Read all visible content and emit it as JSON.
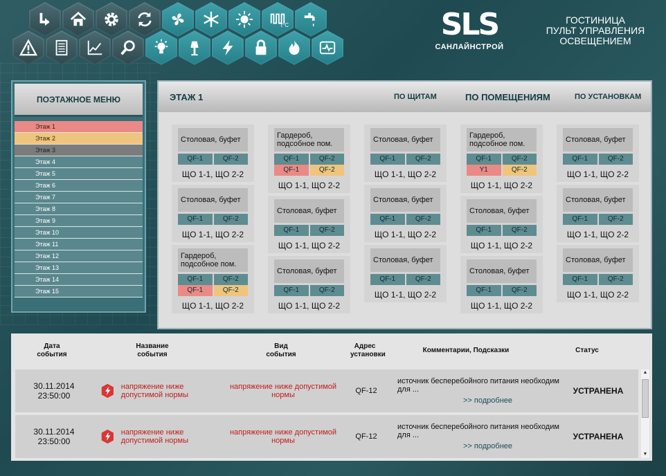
{
  "toolbar": {
    "row1": [
      {
        "icon": "back-arrow-icon"
      },
      {
        "icon": "home-icon"
      },
      {
        "icon": "gear-icon"
      },
      {
        "icon": "refresh-icon"
      },
      {
        "icon": "fan-icon"
      },
      {
        "icon": "snowflake-icon"
      },
      {
        "icon": "sun-icon"
      },
      {
        "icon": "heater-icon",
        "text": "t°C"
      },
      {
        "icon": "faucet-icon"
      }
    ],
    "row2": [
      {
        "icon": "warning-icon"
      },
      {
        "icon": "document-icon"
      },
      {
        "icon": "chart-icon"
      },
      {
        "icon": "search-icon"
      },
      {
        "icon": "lightbulb-icon"
      },
      {
        "icon": "lamp-icon"
      },
      {
        "icon": "lightning-icon"
      },
      {
        "icon": "lock-icon"
      },
      {
        "icon": "fire-icon"
      },
      {
        "icon": "oscilloscope-icon"
      }
    ]
  },
  "logo": {
    "mark": "SLS",
    "name": "САНЛАЙНСТРОЙ"
  },
  "header": {
    "line1": "ГОСТИНИЦА",
    "line2": "ПУЛЬТ УПРАВЛЕНИЯ",
    "line3": "ОСВЕЩЕНИЕМ"
  },
  "menu": {
    "title": "ПОЭТАЖНОЕ МЕНЮ",
    "floors": [
      "Этаж 1",
      "Этаж 2",
      "Этаж 3",
      "Этаж 4",
      "Этаж 5",
      "Этаж 6",
      "Этаж 7",
      "Этаж 8",
      "Этаж 9",
      "Этаж 10",
      "Этаж 11",
      "Этаж 12",
      "Этаж 13",
      "Этаж 14",
      "Этаж 15"
    ]
  },
  "main": {
    "floor": "ЭТАЖ 1",
    "tabs": [
      "ПО ЩИТАМ",
      "ПО ПОМЕЩЕНИЯМ",
      "ПО УСТАНОВКАМ"
    ]
  },
  "columns": [
    [
      {
        "name": "Столовая, буфет",
        "qf": [
          [
            "QF-1",
            "QF-2"
          ]
        ],
        "foot": "ЩО 1-1, ЩО 2-2"
      },
      {
        "name": "Столовая, буфет",
        "qf": [
          [
            "QF-1",
            "QF-2"
          ]
        ],
        "foot": "ЩО 1-1, ЩО 2-2"
      },
      {
        "name": "Гардероб, подсобное пом.",
        "qf": [
          [
            "QF-1",
            "QF-2"
          ]
        ],
        "foot": "ЩО 1-1, ЩО 2-2",
        "alarm": [
          "QF-1",
          "QF-2"
        ]
      }
    ],
    [
      {
        "name": "Гардероб, подсобное пом.",
        "qf": [
          [
            "QF-1",
            "QF-2"
          ]
        ],
        "foot": "ЩО 1-1, ЩО 2-2",
        "alarm": [
          "QF-1",
          "QF-2"
        ]
      },
      {
        "name": "Столовая, буфет",
        "qf": [
          [
            "QF-1",
            "QF-2"
          ]
        ],
        "foot": "ЩО 1-1, ЩО 2-2"
      },
      {
        "name": "Столовая, буфет",
        "qf": [
          [
            "QF-1",
            "QF-2"
          ]
        ],
        "foot": "ЩО 1-1, ЩО 2-2"
      }
    ],
    [
      {
        "name": "Столовая, буфет",
        "qf": [
          [
            "QF-1",
            "QF-2"
          ]
        ],
        "foot": "ЩО 1-1, ЩО 2-2"
      },
      {
        "name": "Столовая, буфет",
        "qf": [
          [
            "QF-1",
            "QF-2"
          ]
        ],
        "foot": "ЩО 1-1, ЩО 2-2"
      },
      {
        "name": "Столовая, буфет",
        "qf": [
          [
            "QF-1",
            "QF-2"
          ]
        ],
        "foot": "ЩО 1-1, ЩО 2-2"
      }
    ],
    [
      {
        "name": "Гардероб, подсобное пом.",
        "qf": [
          [
            "QF-1",
            "QF-2"
          ]
        ],
        "foot": "ЩО 1-1, ЩО 2-2",
        "alarm": [
          "Y1",
          "QF-2"
        ]
      },
      {
        "name": "Столовая, буфет",
        "qf": [
          [
            "QF-1",
            "QF-2"
          ]
        ],
        "foot": "ЩО 1-1, ЩО 2-2"
      },
      {
        "name": "Столовая, буфет",
        "qf": [
          [
            "QF-1",
            "QF-2"
          ]
        ],
        "foot": "ЩО 1-1, ЩО 2-2"
      }
    ],
    [
      {
        "name": "Столовая, буфет",
        "qf": [
          [
            "QF-1",
            "QF-2"
          ]
        ],
        "foot": "ЩО 1-1, ЩО 2-2"
      },
      {
        "name": "Столовая, буфет",
        "qf": [
          [
            "QF-1",
            "QF-2"
          ]
        ],
        "foot": "ЩО 1-1, ЩО 2-2"
      },
      {
        "name": "Столовая, буфет",
        "qf": [
          [
            "QF-1",
            "QF-2"
          ]
        ],
        "foot": "ЩО 1-1, ЩО 2-2"
      }
    ]
  ],
  "log": {
    "headers": {
      "date": "Дата события",
      "name": "Название события",
      "type": "Вид события",
      "addr": "Адрес установки",
      "comment": "Комментарии, Подсказки",
      "status": "Статус"
    },
    "rows": [
      {
        "date": "30.11.2014",
        "time": "23:50:00",
        "name": "напряжение ниже допустимой нормы",
        "type": "напряжение ниже допустимой нормы",
        "addr": "QF-12",
        "comment": "источник бесперебойного питания необходим для ...",
        "more": ">> подробнее",
        "status": "УСТРАНЕНА"
      },
      {
        "date": "30.11.2014",
        "time": "23:50:00",
        "name": "напряжение ниже допустимой нормы",
        "type": "напряжение ниже допустимой нормы",
        "addr": "QF-12",
        "comment": "источник бесперебойного питания необходим для ...",
        "more": ">> подробнее",
        "status": "УСТРАНЕНА"
      }
    ]
  }
}
